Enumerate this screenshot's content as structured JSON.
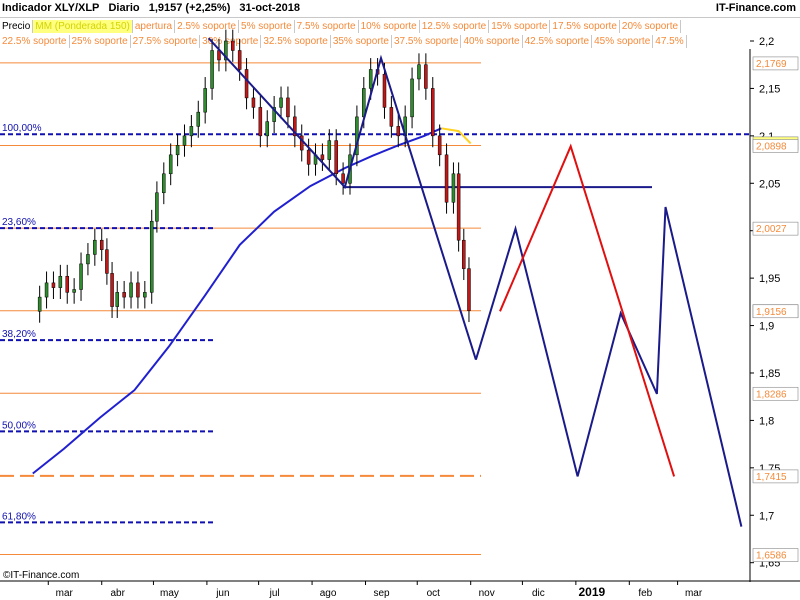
{
  "header": {
    "indicator": "Indicador XLY/XLP",
    "timeframe": "Diario",
    "last_change": "1,9157 (+2,25%)",
    "date": "31-oct-2018",
    "site": "IT-Finance.com"
  },
  "indicator_rows": [
    [
      {
        "label": "Precio",
        "color": "#000000"
      },
      {
        "label": "MM (Ponderada 150)",
        "color": "#d4d400",
        "bg": "#ffff80"
      },
      {
        "label": "apertura",
        "color": "#f58a3a"
      },
      {
        "label": "2.5% soporte",
        "color": "#f58a3a"
      },
      {
        "label": "5% soporte",
        "color": "#f58a3a"
      },
      {
        "label": "7.5% soporte",
        "color": "#f58a3a"
      },
      {
        "label": "10% soporte",
        "color": "#f58a3a"
      },
      {
        "label": "12.5% soporte",
        "color": "#f58a3a"
      },
      {
        "label": "15% soporte",
        "color": "#f58a3a"
      },
      {
        "label": "17.5% soporte",
        "color": "#f58a3a"
      },
      {
        "label": "20% soporte",
        "color": "#f58a3a"
      }
    ],
    [
      {
        "label": "22.5% soporte",
        "color": "#f58a3a"
      },
      {
        "label": "25% soporte",
        "color": "#f58a3a"
      },
      {
        "label": "27.5% soporte",
        "color": "#f58a3a"
      },
      {
        "label": "30% soporte",
        "color": "#f58a3a"
      },
      {
        "label": "32.5% soporte",
        "color": "#f58a3a"
      },
      {
        "label": "35% soporte",
        "color": "#f58a3a"
      },
      {
        "label": "37.5% soporte",
        "color": "#f58a3a"
      },
      {
        "label": "40% soporte",
        "color": "#f58a3a"
      },
      {
        "label": "42.5% soporte",
        "color": "#f58a3a"
      },
      {
        "label": "45% soporte",
        "color": "#f58a3a"
      },
      {
        "label": "47.5%",
        "color": "#f58a3a"
      }
    ]
  ],
  "copyright": "©IT-Finance.com",
  "chart_data": {
    "type": "line",
    "x_axis_labels": [
      "mar",
      "abr",
      "may",
      "jun",
      "jul",
      "ago",
      "sep",
      "oct",
      "nov",
      "dic",
      "2019",
      "feb",
      "mar"
    ],
    "x_axis_bold": [
      "2019"
    ],
    "y_axis_ticks": [
      1.65,
      1.7,
      1.75,
      1.8,
      1.85,
      1.9,
      1.95,
      2.0,
      2.05,
      2.1,
      2.15,
      2.2
    ],
    "y_axis_tick_labels": [
      "1,65",
      "1,7",
      "1,75",
      "1,8",
      "1,85",
      "1,9",
      "1,95",
      "2",
      "2,05",
      "2,1",
      "2,15",
      "2,2"
    ],
    "ylim": [
      1.6444,
      2.2
    ],
    "price_labels": [
      {
        "text": "2,1769",
        "value": 2.1769,
        "color": "#f58a3a",
        "bg": "#ffffff"
      },
      {
        "text": "2,0926",
        "value": 2.0926,
        "color": "#e0c000",
        "bg": "#ffff80"
      },
      {
        "text": "2,0898",
        "value": 2.0898,
        "color": "#f58a3a",
        "bg": "#ffffff"
      },
      {
        "text": "2,0027",
        "value": 2.0027,
        "color": "#f58a3a",
        "bg": "#ffffff"
      },
      {
        "text": "1,9157",
        "value": 1.9157,
        "color": "#000000",
        "bg": "#ffff80"
      },
      {
        "text": "1,9156",
        "value": 1.9156,
        "color": "#f58a3a",
        "bg": "#ffffff"
      },
      {
        "text": "1,8286",
        "value": 1.8286,
        "color": "#f58a3a",
        "bg": "#ffffff"
      },
      {
        "text": "1,7415",
        "value": 1.7415,
        "color": "#f58a3a",
        "bg": "#ffffff"
      },
      {
        "text": "1,6586",
        "value": 1.6586,
        "color": "#f58a3a",
        "bg": "#ffffff"
      }
    ],
    "support_levels": [
      2.1769,
      2.0898,
      2.0027,
      1.9156,
      1.8286,
      1.6586
    ],
    "dashed_orange_level": 1.7415,
    "fib_levels": [
      {
        "label": "23,60%",
        "value": 2.0027
      },
      {
        "label": "38,20%",
        "value": 1.8847
      },
      {
        "label": "50,00%",
        "value": 1.7885
      },
      {
        "label": "61,80%",
        "value": 1.6925
      }
    ],
    "fib_100_level": {
      "label": "100,00%",
      "value": 2.1017
    },
    "neckline": {
      "value": 2.0459
    },
    "moving_average": {
      "name": "MM (Ponderada 150)",
      "color": "#2020d0",
      "points": [
        [
          "2018-02-20",
          1.744
        ],
        [
          "2018-03-10",
          1.77
        ],
        [
          "2018-03-31",
          1.803
        ],
        [
          "2018-04-20",
          1.832
        ],
        [
          "2018-05-10",
          1.878
        ],
        [
          "2018-05-31",
          1.932
        ],
        [
          "2018-06-20",
          1.985
        ],
        [
          "2018-07-10",
          2.02
        ],
        [
          "2018-07-31",
          2.047
        ],
        [
          "2018-08-20",
          2.066
        ],
        [
          "2018-09-05",
          2.079
        ],
        [
          "2018-09-20",
          2.09
        ],
        [
          "2018-10-05",
          2.1
        ],
        [
          "2018-10-15",
          2.108
        ]
      ]
    },
    "ma_projection": {
      "color": "#ffd21f",
      "points": [
        [
          "2018-10-15",
          2.108
        ],
        [
          "2018-10-25",
          2.105
        ],
        [
          "2018-11-01",
          2.092
        ]
      ]
    },
    "price_series": [
      [
        "2018-02-21",
        1.915
      ],
      [
        "2018-02-24",
        1.93
      ],
      [
        "2018-02-28",
        1.945
      ],
      [
        "2018-03-04",
        1.94
      ],
      [
        "2018-03-08",
        1.952
      ],
      [
        "2018-03-12",
        1.935
      ],
      [
        "2018-03-16",
        1.938
      ],
      [
        "2018-03-20",
        1.965
      ],
      [
        "2018-03-24",
        1.975
      ],
      [
        "2018-03-28",
        1.99
      ],
      [
        "2018-04-01",
        1.98
      ],
      [
        "2018-04-04",
        1.955
      ],
      [
        "2018-04-07",
        1.92
      ],
      [
        "2018-04-10",
        1.935
      ],
      [
        "2018-04-14",
        1.93
      ],
      [
        "2018-04-18",
        1.945
      ],
      [
        "2018-04-22",
        1.93
      ],
      [
        "2018-04-26",
        1.935
      ],
      [
        "2018-04-30",
        2.01
      ],
      [
        "2018-05-03",
        2.04
      ],
      [
        "2018-05-07",
        2.06
      ],
      [
        "2018-05-11",
        2.08
      ],
      [
        "2018-05-15",
        2.09
      ],
      [
        "2018-05-19",
        2.1
      ],
      [
        "2018-05-23",
        2.11
      ],
      [
        "2018-05-27",
        2.125
      ],
      [
        "2018-05-31",
        2.15
      ],
      [
        "2018-06-04",
        2.19
      ],
      [
        "2018-06-08",
        2.18
      ],
      [
        "2018-06-12",
        2.2
      ],
      [
        "2018-06-16",
        2.19
      ],
      [
        "2018-06-20",
        2.17
      ],
      [
        "2018-06-24",
        2.14
      ],
      [
        "2018-06-28",
        2.13
      ],
      [
        "2018-07-02",
        2.1
      ],
      [
        "2018-07-06",
        2.115
      ],
      [
        "2018-07-10",
        2.13
      ],
      [
        "2018-07-14",
        2.14
      ],
      [
        "2018-07-18",
        2.12
      ],
      [
        "2018-07-22",
        2.1
      ],
      [
        "2018-07-26",
        2.085
      ],
      [
        "2018-07-30",
        2.07
      ],
      [
        "2018-08-03",
        2.08
      ],
      [
        "2018-08-07",
        2.075
      ],
      [
        "2018-08-11",
        2.095
      ],
      [
        "2018-08-15",
        2.06
      ],
      [
        "2018-08-19",
        2.05
      ],
      [
        "2018-08-23",
        2.08
      ],
      [
        "2018-08-27",
        2.12
      ],
      [
        "2018-08-31",
        2.15
      ],
      [
        "2018-09-04",
        2.17
      ],
      [
        "2018-09-08",
        2.165
      ],
      [
        "2018-09-12",
        2.13
      ],
      [
        "2018-09-16",
        2.11
      ],
      [
        "2018-09-20",
        2.1
      ],
      [
        "2018-09-24",
        2.12
      ],
      [
        "2018-09-28",
        2.16
      ],
      [
        "2018-10-02",
        2.175
      ],
      [
        "2018-10-06",
        2.15
      ],
      [
        "2018-10-10",
        2.1
      ],
      [
        "2018-10-14",
        2.08
      ],
      [
        "2018-10-18",
        2.03
      ],
      [
        "2018-10-22",
        2.06
      ],
      [
        "2018-10-25",
        1.99
      ],
      [
        "2018-10-28",
        1.96
      ],
      [
        "2018-10-31",
        1.9157
      ]
    ],
    "pattern_lines": [
      {
        "name": "head-shoulders-pattern",
        "color": "#1a1a8a",
        "points": [
          [
            "2018-06-02",
            2.203
          ],
          [
            "2018-08-20",
            2.046
          ],
          [
            "2018-09-10",
            2.182
          ],
          [
            "2018-11-04",
            1.864
          ]
        ]
      }
    ],
    "projection_lines": [
      {
        "name": "projection-blue",
        "color": "#1a1a8a",
        "points": [
          [
            "2018-11-04",
            1.864
          ],
          [
            "2018-11-27",
            2.002
          ],
          [
            "2019-01-02",
            1.741
          ],
          [
            "2019-01-27",
            1.913
          ],
          [
            "2019-02-17",
            1.828
          ],
          [
            "2019-02-22",
            2.025
          ],
          [
            "2019-04-07",
            1.688
          ]
        ]
      },
      {
        "name": "projection-red",
        "color": "#e01010",
        "points": [
          [
            "2018-11-18",
            1.915
          ],
          [
            "2018-12-29",
            2.089
          ],
          [
            "2019-02-27",
            1.741
          ]
        ]
      }
    ]
  }
}
